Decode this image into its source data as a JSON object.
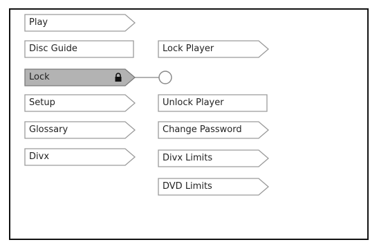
{
  "main_menu": {
    "items": [
      {
        "label": "Play"
      },
      {
        "label": "Disc Guide"
      },
      {
        "label": "Lock"
      },
      {
        "label": "Setup"
      },
      {
        "label": "Glossary"
      },
      {
        "label": "Divx"
      }
    ]
  },
  "lock_submenu": {
    "items": [
      {
        "label": "Lock Player"
      },
      {
        "label": "Unlock Player"
      },
      {
        "label": "Change Password"
      },
      {
        "label": "Divx Limits"
      },
      {
        "label": "DVD Limits"
      }
    ]
  },
  "selected_main_item": "Lock",
  "colors": {
    "selected_fill": "#b3b3b3",
    "item_fill": "#ffffff",
    "border": "#9a9a9a",
    "text": "#222222"
  }
}
